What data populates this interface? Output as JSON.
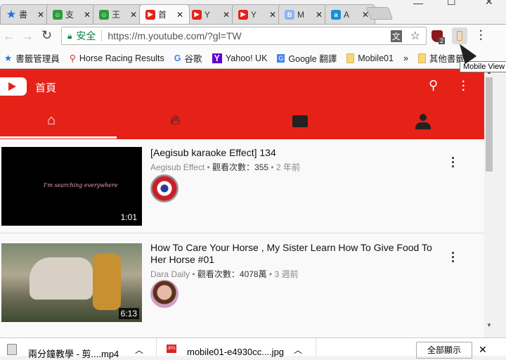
{
  "tabs": [
    {
      "label": "書",
      "icon": "star",
      "color": "#1a73e8",
      "close": "✕"
    },
    {
      "label": "支",
      "icon": "android",
      "color": "#2a9d3a",
      "close": "✕"
    },
    {
      "label": "王",
      "icon": "android",
      "color": "#2a9d3a",
      "close": "✕"
    },
    {
      "label": "首",
      "icon": "youtube",
      "color": "#e62117",
      "close": "✕"
    },
    {
      "label": "Y",
      "icon": "youtube",
      "color": "#e62117",
      "close": "✕"
    },
    {
      "label": "Y",
      "icon": "youtube",
      "color": "#e62117",
      "close": "✕"
    },
    {
      "label": "M",
      "icon": "B",
      "color": "#8ab4f8",
      "close": "✕"
    },
    {
      "label": "A",
      "icon": "a",
      "color": "#1a8fd6",
      "close": "✕"
    }
  ],
  "toolbar": {
    "secure": "安全",
    "url": "https://m.youtube.com/?gl=TW",
    "ublock_count": "2"
  },
  "bookmarks": [
    {
      "label": "書籤管理員"
    },
    {
      "label": "Horse Racing Results"
    },
    {
      "label": "谷歌"
    },
    {
      "label": "Yahoo! UK"
    },
    {
      "label": "Google 翻譯"
    },
    {
      "label": "Mobile01"
    },
    {
      "label": "»"
    },
    {
      "label": "其他書籤"
    }
  ],
  "tooltip": "Mobile View",
  "youtube": {
    "title": "首頁"
  },
  "videos": [
    {
      "title": "[Aegisub karaoke Effect] 134",
      "channel": "Aegisub Effect",
      "views": "觀看次數：355",
      "age": "2 年前",
      "duration": "1:01",
      "thumb_text": "I'm searching everywhere"
    },
    {
      "title": "How To Care Your Horse , My Sister Learn How To Give Food To Her Horse #01",
      "channel": "Dara Daily",
      "views": "觀看次數：4078萬",
      "age": "3 週前",
      "duration": "6:13"
    }
  ],
  "downloads": [
    {
      "name": "兩分鐘教學 - 剪....mp4"
    },
    {
      "name": "mobile01-e4930cc....jpg"
    }
  ],
  "download_bar": {
    "show_all": "全部顯示",
    "close": "✕"
  }
}
